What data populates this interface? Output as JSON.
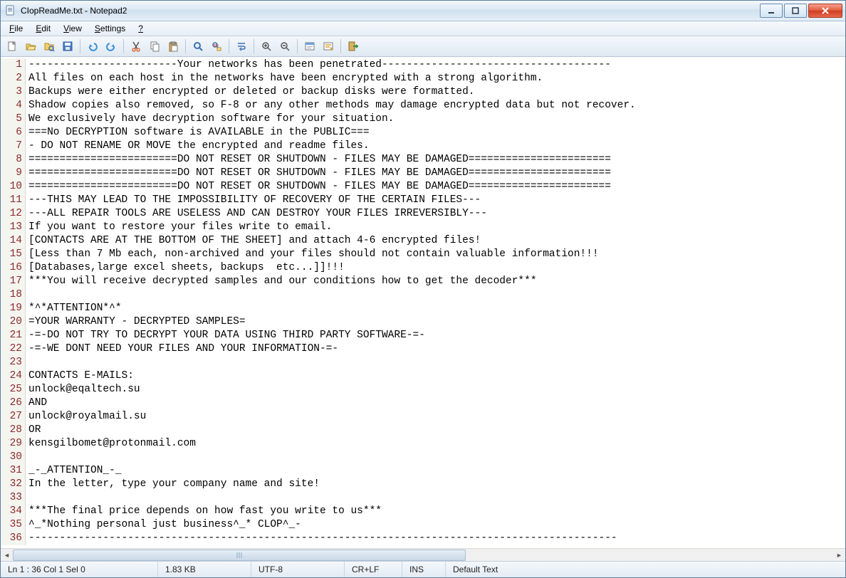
{
  "app": {
    "icon": "notepad2-icon",
    "title": "CIopReadMe.txt - Notepad2"
  },
  "menus": {
    "file": "File",
    "edit": "Edit",
    "view": "View",
    "settings": "Settings",
    "help": "?"
  },
  "toolbar_icons": [
    "new",
    "open",
    "browse",
    "save",
    "|",
    "undo",
    "redo",
    "|",
    "cut",
    "copy",
    "paste",
    "|",
    "find",
    "replace",
    "|",
    "wordwrap",
    "|",
    "zoom-in",
    "zoom-out",
    "|",
    "scheme",
    "customize",
    "|",
    "exit"
  ],
  "statusbar": {
    "pos": "Ln 1 : 36   Col 1   Sel 0",
    "size": "1.83 KB",
    "encoding": "UTF-8",
    "eol": "CR+LF",
    "ovr": "INS",
    "lexer": "Default Text"
  },
  "lines": [
    "------------------------Your networks has been penetrated-------------------------------------",
    "All files on each host in the networks have been encrypted with a strong algorithm.",
    "Backups were either encrypted or deleted or backup disks were formatted.",
    "Shadow copies also removed, so F-8 or any other methods may damage encrypted data but not recover.",
    "We exclusively have decryption software for your situation.",
    "===No DECRYPTION software is AVAILABLE in the PUBLIC===",
    "- DO NOT RENAME OR MOVE the encrypted and readme files.",
    "========================DO NOT RESET OR SHUTDOWN - FILES MAY BE DAMAGED=======================",
    "========================DO NOT RESET OR SHUTDOWN - FILES MAY BE DAMAGED=======================",
    "========================DO NOT RESET OR SHUTDOWN - FILES MAY BE DAMAGED=======================",
    "---THIS MAY LEAD TO THE IMPOSSIBILITY OF RECOVERY OF THE CERTAIN FILES---",
    "---ALL REPAIR TOOLS ARE USELESS AND CAN DESTROY YOUR FILES IRREVERSIBLY---",
    "If you want to restore your files write to email.",
    "[CONTACTS ARE AT THE BOTTOM OF THE SHEET] and attach 4-6 encrypted files!",
    "[Less than 7 Mb each, non-archived and your files should not contain valuable information!!!",
    "[Databases,large excel sheets, backups  etc...]]!!!",
    "***You will receive decrypted samples and our conditions how to get the decoder***",
    "",
    "*^*ATTENTION*^*",
    "=YOUR WARRANTY - DECRYPTED SAMPLES=",
    "-=-DO NOT TRY TO DECRYPT YOUR DATA USING THIRD PARTY SOFTWARE-=-",
    "-=-WE DONT NEED YOUR FILES AND YOUR INFORMATION-=-",
    "",
    "CONTACTS E-MAILS:",
    "unlock@eqaltech.su",
    "AND",
    "unlock@royalmail.su",
    "OR",
    "kensgilbomet@protonmail.com",
    "",
    "_-_ATTENTION_-_",
    "In the letter, type your company name and site!",
    "",
    "***The final price depends on how fast you write to us***",
    "^_*Nothing personal just business^_* CLOP^_-",
    "-----------------------------------------------------------------------------------------------"
  ]
}
